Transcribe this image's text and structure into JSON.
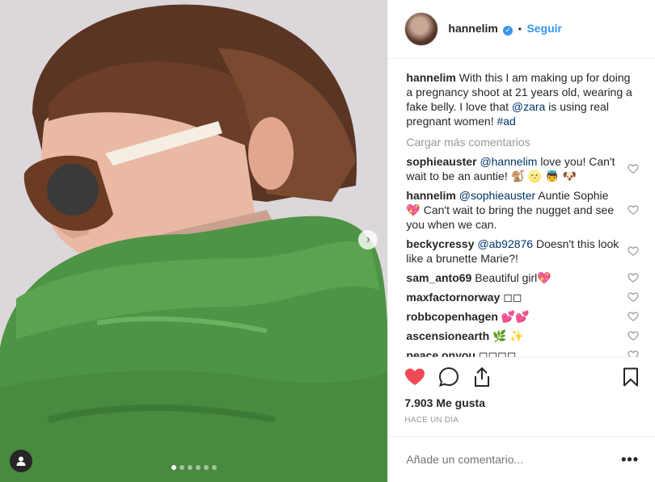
{
  "post": {
    "username": "hannelim",
    "follow_label": "Seguir",
    "caption": {
      "user": "hannelim",
      "text_1": "With this I am making up for doing a pregnancy shoot at 21 years old, wearing a fake belly. I love that ",
      "mention": "@zara",
      "text_2": " is using real pregnant women! ",
      "hashtag": "#ad"
    },
    "load_more": "Cargar más comentarios",
    "comments": [
      {
        "user": "sophieauster",
        "mention": "@hannelim",
        "text": " love you! Can't wait to be an auntie! 🐒 🌝 👼 🐶"
      },
      {
        "user": "hannelim",
        "mention": "@sophieauster",
        "text": " Auntie Sophie 💖 Can't wait to bring the nugget and see you when we can."
      },
      {
        "user": "beckycressy",
        "mention": "@ab92876",
        "text": " Doesn't this look like a brunette Marie?!"
      },
      {
        "user": "sam_anto69",
        "mention": "",
        "text": "Beautiful girl💖"
      },
      {
        "user": "maxfactornorway",
        "mention": "",
        "text": "◻◻"
      },
      {
        "user": "robbcopenhagen",
        "mention": "",
        "text": "💕💕"
      },
      {
        "user": "ascensionearth",
        "mention": "",
        "text": "🌿 ✨"
      },
      {
        "user": "peace.onyou",
        "mention": "",
        "text": "◻◻◻◻"
      }
    ],
    "likes": "7.903 Me gusta",
    "timestamp": "HACE UN DÍA",
    "add_comment_placeholder": "Añade un comentario...",
    "more_label": "•••",
    "carousel": {
      "count": 6,
      "active": 0
    },
    "colors": {
      "like_red": "#ed4956",
      "link_blue": "#3897f0",
      "mention_blue": "#003569",
      "sweater_green": "#4e9446"
    },
    "icons": [
      "user-tag-icon",
      "chevron-right-icon",
      "verified-icon",
      "heart-icon",
      "comment-icon",
      "share-icon",
      "bookmark-icon"
    ]
  }
}
